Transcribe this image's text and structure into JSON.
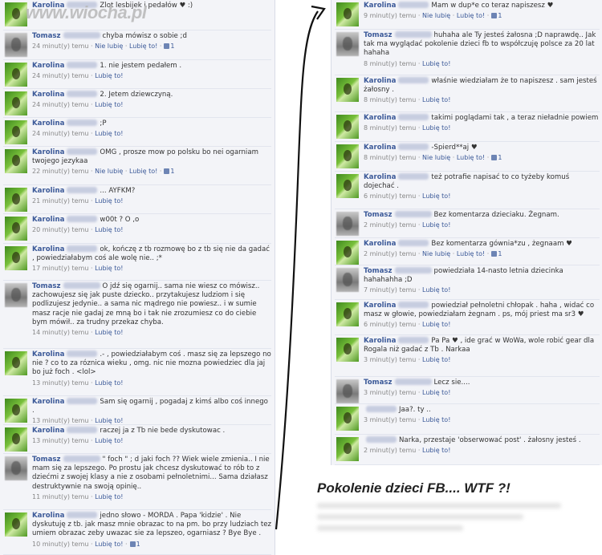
{
  "watermark": "www.wiocha.pl",
  "caption": "Pokolenie dzieci FB....    WTF ?!",
  "like_label": "Lubię to!",
  "unlike_label": "Nie lubię",
  "left_posts": [
    {
      "author": "Karolina",
      "avatar": "k",
      "text": "Zlot lesbijek i pedałów ♥ :)",
      "time": "",
      "likes": ""
    },
    {
      "author": "Tomasz",
      "avatar": "t",
      "text": "chyba mówisz o sobie ;d",
      "time": "24 minut(y) temu",
      "likes": "1",
      "unlike": true
    },
    {
      "author": "Karolina",
      "avatar": "k",
      "text": "1. nie jestem pedałem .",
      "time": "24 minut(y) temu",
      "likes": ""
    },
    {
      "author": "Karolina",
      "avatar": "k",
      "text": "2. Jetem dziewczyną.",
      "time": "24 minut(y) temu",
      "likes": ""
    },
    {
      "author": "Karolina",
      "avatar": "k",
      "text": ";P",
      "time": "24 minut(y) temu",
      "likes": ""
    },
    {
      "author": "Karolina",
      "avatar": "k",
      "text": "OMG , prosze mow po polsku bo nei ogarniam twojego jezykaa",
      "time": "22 minut(y) temu",
      "likes": "1",
      "unlike": true
    },
    {
      "author": "Karolina",
      "avatar": "k",
      "text": "... AYFKM?",
      "time": "21 minut(y) temu",
      "likes": ""
    },
    {
      "author": "Karolina",
      "avatar": "k",
      "text": "w00t ? O ,o",
      "time": "20 minut(y) temu",
      "likes": ""
    },
    {
      "author": "Karolina",
      "avatar": "k",
      "text": "ok, kończę z tb rozmowę bo z tb się nie da gadać , powiedziałabym coś ale wolę nie.. ;*",
      "time": "17 minut(y) temu",
      "likes": ""
    },
    {
      "author": "Tomasz",
      "avatar": "t",
      "text": "O jdź się ogarnij.. sama nie wiesz co mówisz.. zachowujesz się jak puste dziecko.. przytakujesz ludziom i się podlizujesz jedynie.. a sama nic mądrego nie powiesz.. i w sumie masz racje nie gadaj ze mną bo i tak nie zrozumiesz co do ciebie bym mówił.. za trudny przekaz chyba.",
      "time": "14 minut(y) temu",
      "likes": ""
    },
    {
      "author": "Karolina",
      "avatar": "k",
      "text": ".- , powiedziałabym coś . masz się za lepszego no nie ? co to za róznica wieku , omg. nic nie mozna powiedziec dla jaj bo już foch . <lol>",
      "time": "13 minut(y) temu",
      "likes": ""
    },
    {
      "author": "Karolina",
      "avatar": "k",
      "text": "Sam się ogarnij , pogadaj z kimś albo coś innego .",
      "time": "13 minut(y) temu",
      "likes": ""
    },
    {
      "author": "Karolina",
      "avatar": "k",
      "text": "raczej ja z Tb nie bede dyskutowac .",
      "time": "13 minut(y) temu",
      "likes": ""
    },
    {
      "author": "Tomasz",
      "avatar": "t",
      "text": "\" foch \" ; d jaki foch ?? Wiek wiele zmienia.. I nie mam się za lepszego. Po prostu jak chcesz dyskutować to rób to z dziećmi z swojej klasy a nie z osobami pełnoletnimi... Sama działasz destruktywnie na swoją opinię..",
      "time": "11 minut(y) temu",
      "likes": ""
    },
    {
      "author": "Karolina",
      "avatar": "k",
      "text": "jedno słowo - MORDA . Papa 'kidzie' . Nie dyskutuję z tb. jak masz mnie obrazac to na pm. bo przy ludziach tez umiem obrazac zeby uwazac sie za lepszeo, ogarniasz ? Bye Bye .",
      "time": "10 minut(y) temu",
      "likes": "1"
    }
  ],
  "right_posts": [
    {
      "author": "Karolina",
      "avatar": "k",
      "text": "Mam w dup*e co teraz napiszesz ♥",
      "time": "9 minut(y) temu",
      "likes": "1",
      "unlike": true
    },
    {
      "author": "Tomasz",
      "avatar": "t",
      "text": "huhaha ale Ty jesteś żałosna ;D naprawdę.. Jak tak ma wyglądać pokolenie dzieci fb to współczuję polsce za 20 lat hahaha",
      "time": "8 minut(y) temu",
      "likes": ""
    },
    {
      "author": "Karolina",
      "avatar": "k",
      "text": "właśnie wiedziałam że to napiszesz . sam jesteś żałosny .",
      "time": "8 minut(y) temu",
      "likes": ""
    },
    {
      "author": "Karolina",
      "avatar": "k",
      "text": "takimi poglądami tak , a teraz nieładnie powiem",
      "time": "8 minut(y) temu",
      "likes": ""
    },
    {
      "author": "Karolina",
      "avatar": "k",
      "text": "-Spierd**aj ♥",
      "time": "8 minut(y) temu",
      "likes": "1",
      "unlike": true
    },
    {
      "author": "Karolina",
      "avatar": "k",
      "text": "też potrafie napisać to co tyżeby komuś dojechać .",
      "time": "6 minut(y) temu",
      "likes": ""
    },
    {
      "author": "Tomasz",
      "avatar": "t",
      "text": "Bez komentarza dzieciaku. Żegnam.",
      "time": "2 minut(y) temu",
      "likes": ""
    },
    {
      "author": "Karolina",
      "avatar": "k",
      "text": "Bez komentarza gównia*zu , żegnaam ♥",
      "time": "2 minut(y) temu",
      "likes": "1",
      "unlike": true
    },
    {
      "author": "Tomasz",
      "avatar": "t",
      "text": "powiedziała 14-nasto letnia dziecinka hahahahha ;D",
      "time": "7 minut(y) temu",
      "likes": ""
    },
    {
      "author": "Karolina",
      "avatar": "k",
      "text": "powiedział pełnoletni chłopak . haha , widać co masz w głowie, powiedziałam żegnam . ps, mój priest ma sr3 ♥",
      "time": "6 minut(y) temu",
      "likes": ""
    },
    {
      "author": "Karolina",
      "avatar": "k",
      "text": "Pa Pa ♥ , ide grać w WoWa, wole robić gear dla Rogala niż gadać z Tb . Narkaa",
      "time": "3 minut(y) temu",
      "likes": ""
    },
    {
      "author": "Tomasz",
      "avatar": "t",
      "text": "Lecz sie....",
      "time": "3 minut(y) temu",
      "likes": ""
    },
    {
      "author": "",
      "avatar": "k",
      "text": "Jaa?. ty ..",
      "time": "3 minut(y) temu",
      "likes": ""
    },
    {
      "author": "",
      "avatar": "k",
      "text": "Narka, przestaje 'obserwować post' . żałosny jesteś .",
      "time": "2 minut(y) temu",
      "likes": ""
    }
  ]
}
